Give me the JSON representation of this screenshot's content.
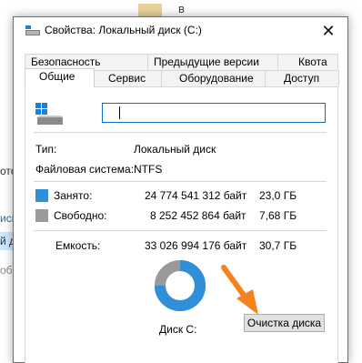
{
  "background": {
    "folder_letter": "в",
    "text_1": "ото",
    "text_2": "иск",
    "text_3": "й д",
    "text_4": "обо"
  },
  "dialog": {
    "title": "Свойства: Локальный диск (C:)",
    "close_glyph": "✕",
    "tabs_row1": [
      "Безопасность",
      "Предыдущие версии",
      "Квота"
    ],
    "tabs_row2": [
      "Общие",
      "Сервис",
      "Оборудование",
      "Доступ"
    ],
    "active_tab": "Общие",
    "name_value": "",
    "type_label": "Тип:",
    "type_value": "Локальный диск",
    "fs_label": "Файловая система:",
    "fs_value": "NTFS",
    "used": {
      "label": "Занято:",
      "bytes": "24 774 541 312 байт",
      "size": "23,0 ГБ",
      "color": "#2f8fd8"
    },
    "free": {
      "label": "Свободно:",
      "bytes": "8 252 452 864 байт",
      "size": "7,68 ГБ",
      "color": "#9a9a9a"
    },
    "capacity": {
      "label": "Емкость:",
      "bytes": "33 026 994 176 байт",
      "size": "30,7 ГБ"
    },
    "disk_label": "Диск C:",
    "cleanup_button": "Очистка диска",
    "used_fraction": 0.75
  }
}
